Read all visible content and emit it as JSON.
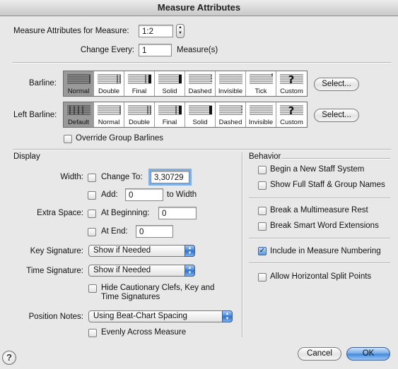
{
  "window": {
    "title": "Measure Attributes"
  },
  "measure_for": {
    "label": "Measure Attributes for Measure:",
    "value": "1:2"
  },
  "change_every": {
    "label": "Change Every:",
    "value": "1",
    "suffix": "Measure(s)"
  },
  "barline": {
    "label": "Barline:",
    "options": [
      "Normal",
      "Double",
      "Final",
      "Solid",
      "Dashed",
      "Invisible",
      "Tick",
      "Custom"
    ],
    "selected": "Normal",
    "select_button": "Select..."
  },
  "left_barline": {
    "label": "Left Barline:",
    "options": [
      "Default",
      "Normal",
      "Double",
      "Final",
      "Solid",
      "Dashed",
      "Invisible",
      "Custom"
    ],
    "selected": "Default",
    "select_button": "Select..."
  },
  "override_group_barlines": {
    "label": "Override Group Barlines",
    "checked": false
  },
  "display": {
    "header": "Display",
    "width_label": "Width:",
    "change_to": {
      "label": "Change To:",
      "checked": false,
      "value": "3,30729"
    },
    "add": {
      "label": "Add:",
      "checked": false,
      "value": "0",
      "suffix": "to Width"
    },
    "extra_space_label": "Extra Space:",
    "at_beginning": {
      "label": "At Beginning:",
      "checked": false,
      "value": "0"
    },
    "at_end": {
      "label": "At End:",
      "checked": false,
      "value": "0"
    },
    "key_signature": {
      "label": "Key Signature:",
      "value": "Show if Needed"
    },
    "time_signature": {
      "label": "Time Signature:",
      "value": "Show if Needed"
    },
    "hide_cautionary": {
      "label_line1": "Hide Cautionary Clefs, Key and",
      "label_line2": "Time Signatures",
      "checked": false
    },
    "position_notes": {
      "label": "Position Notes:",
      "value": "Using Beat-Chart Spacing"
    },
    "evenly": {
      "label": "Evenly Across Measure",
      "checked": false
    }
  },
  "behavior": {
    "header": "Behavior",
    "items": [
      {
        "label": "Begin a New Staff System",
        "checked": false
      },
      {
        "label": "Show Full Staff & Group Names",
        "checked": false
      },
      {
        "label": "Break a Multimeasure Rest",
        "checked": false
      },
      {
        "label": "Break Smart Word Extensions",
        "checked": false
      },
      {
        "label": "Include in Measure Numbering",
        "checked": true
      },
      {
        "label": "Allow Horizontal Split Points",
        "checked": false
      }
    ]
  },
  "buttons": {
    "help": "?",
    "cancel": "Cancel",
    "ok": "OK"
  },
  "colors": {
    "accent": "#3f86dc",
    "focus_ring": "#7fb0e8",
    "selected_segment": "#9a9a9a"
  }
}
